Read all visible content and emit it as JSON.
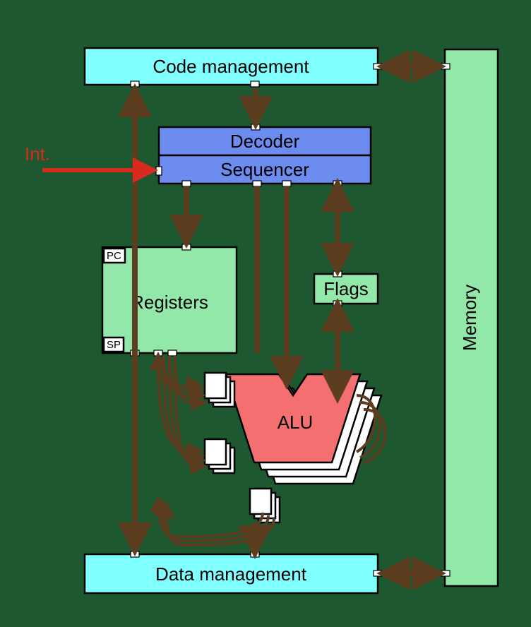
{
  "blocks": {
    "code_management": "Code management",
    "decoder": "Decoder",
    "sequencer": "Sequencer",
    "registers": "Registers",
    "pc": "PC",
    "sp": "SP",
    "flags": "Flags",
    "alu": "ALU",
    "data_management": "Data management",
    "memory": "Memory"
  },
  "external": {
    "interrupt": "Int."
  },
  "palette": {
    "background": "#1e5831",
    "cyan": "#80ffff",
    "blue": "#6c8cf0",
    "green": "#91e8a8",
    "red": "#f47070",
    "arrow": "#5c3d1f",
    "interrupt": "#d82a1e"
  }
}
